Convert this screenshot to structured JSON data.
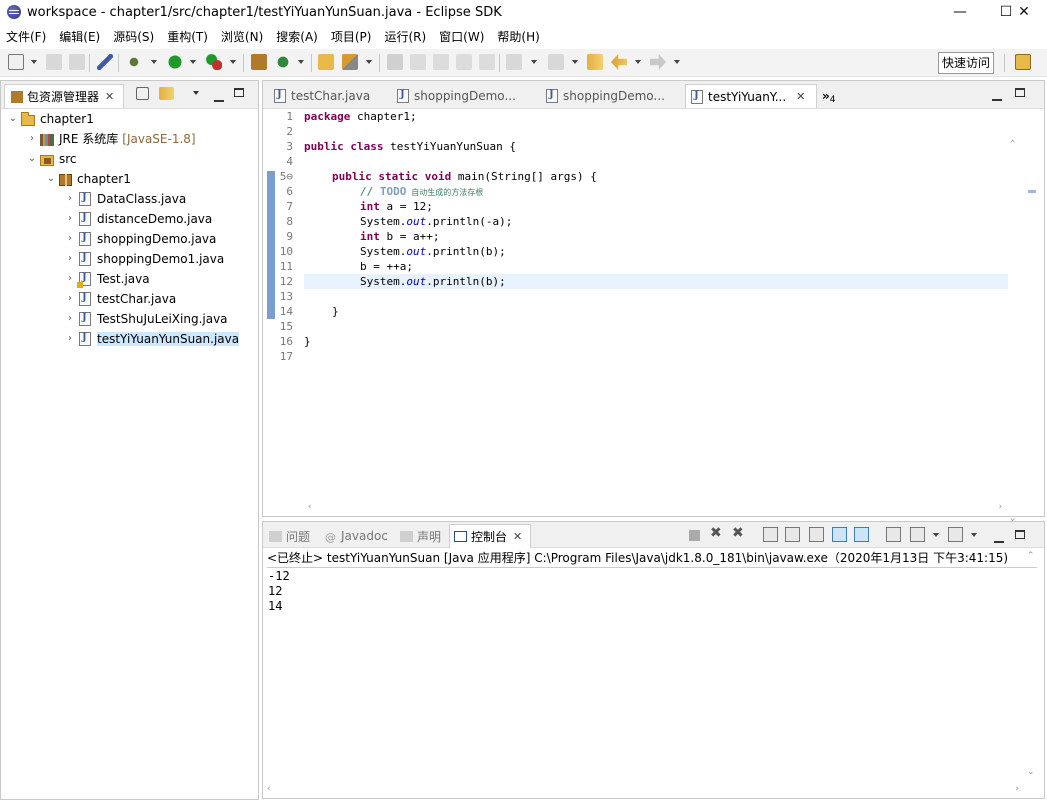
{
  "window": {
    "title": "workspace - chapter1/src/chapter1/testYiYuanYunSuan.java - Eclipse SDK",
    "minimize": "—",
    "maximize": "☐",
    "close": "✕"
  },
  "menu": [
    "文件(F)",
    "编辑(E)",
    "源码(S)",
    "重构(T)",
    "浏览(N)",
    "搜索(A)",
    "项目(P)",
    "运行(R)",
    "窗口(W)",
    "帮助(H)"
  ],
  "toolbar": {
    "quick_access": "快速访问"
  },
  "explorer": {
    "tab_label": "包资源管理器",
    "tab_close": "✕",
    "tree": {
      "project": "chapter1",
      "jre_label": "JRE 系统库",
      "jre_version": "[JavaSE-1.8]",
      "src": "src",
      "package": "chapter1",
      "files": [
        "DataClass.java",
        "distanceDemo.java",
        "shoppingDemo.java",
        "shoppingDemo1.java",
        "Test.java",
        "testChar.java",
        "TestShuJuLeiXing.java",
        "testYiYuanYunSuan.java"
      ]
    }
  },
  "editor": {
    "tabs": [
      "testChar.java",
      "shoppingDemo...",
      "shoppingDemo...",
      "testYiYuanY..."
    ],
    "tab_close": "✕",
    "overflow": "»",
    "overflow_count": "4",
    "line_numbers": [
      "1",
      "2",
      "3",
      "4",
      "5⊖",
      "6",
      "7",
      "8",
      "9",
      "10",
      "11",
      "12",
      "13",
      "14",
      "15",
      "16",
      "17"
    ],
    "code": {
      "l1_kw": "package",
      "l1_rest": " chapter1;",
      "l3_kw": "public class",
      "l3_rest": " testYiYuanYunSuan {",
      "l5_kw": "public static void",
      "l5_rest": " main(String[] args) {",
      "l6_cm": "// ",
      "l6_todo": "TODO",
      "l6_text": " 自动生成的方法存根",
      "l7_kw": "int",
      "l7_rest": " a = 12;",
      "l8_pre": "System.",
      "l8_fld": "out",
      "l8_post": ".println(-a);",
      "l9_kw": "int",
      "l9_rest": " b = a++;",
      "l10_pre": "System.",
      "l10_fld": "out",
      "l10_post": ".println(b);",
      "l11": "b = ++a;",
      "l12_pre": "System.",
      "l12_fld": "out",
      "l12_post": ".println(b);",
      "l14": "}",
      "l16": "}"
    }
  },
  "console": {
    "tabs": [
      "问题",
      "Javadoc",
      "声明",
      "控制台"
    ],
    "tab_close": "✕",
    "header": "<已终止> testYiYuanYunSuan [Java 应用程序] C:\\Program Files\\Java\\jdk1.8.0_181\\bin\\javaw.exe（2020年1月13日 下午3:41:15)",
    "output": [
      "-12",
      "12",
      "14"
    ]
  },
  "colors": {
    "keyword": "#7f0055",
    "comment": "#3f7f5f",
    "field": "#0000c0",
    "selection": "#cce8ff",
    "current_line": "#e8f2fe"
  }
}
